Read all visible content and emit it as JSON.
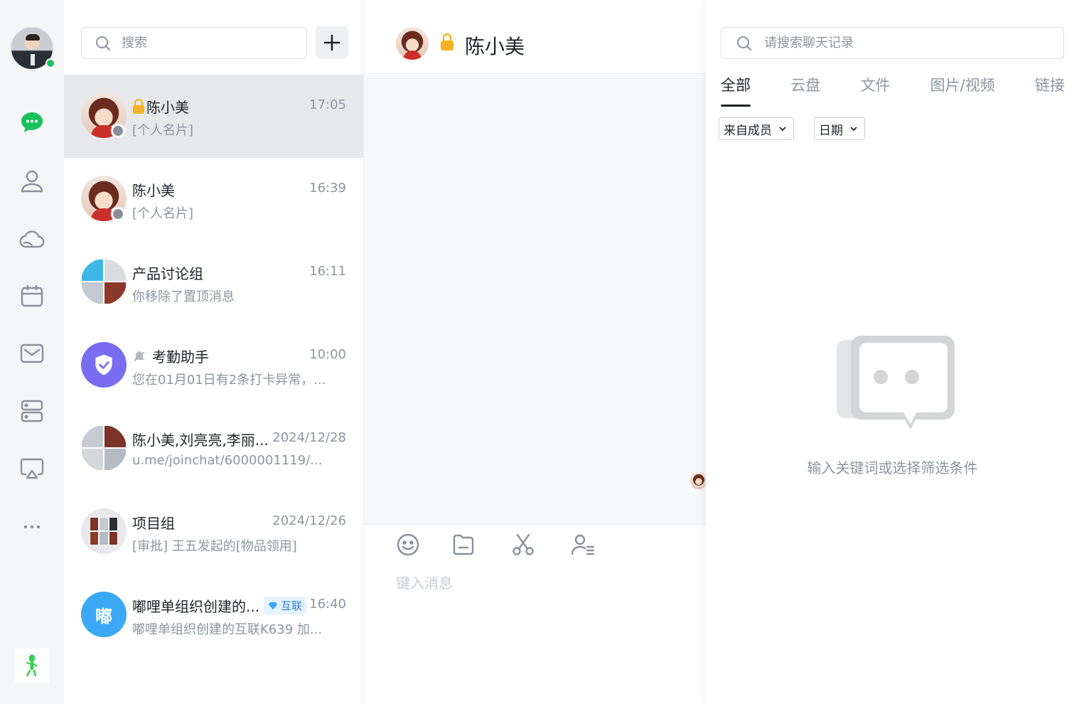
{
  "rail": {
    "items": [
      {
        "name": "messages",
        "icon": "chat-bubble-icon",
        "active": true
      },
      {
        "name": "contacts",
        "icon": "contact-icon"
      },
      {
        "name": "cloud",
        "icon": "cloud-icon"
      },
      {
        "name": "calendar",
        "icon": "calendar-icon"
      },
      {
        "name": "mail",
        "icon": "mail-icon"
      },
      {
        "name": "workspace",
        "icon": "workspace-icon"
      },
      {
        "name": "screencast",
        "icon": "screencast-icon"
      },
      {
        "name": "more",
        "icon": "more-icon"
      }
    ],
    "accent": "#19c25a"
  },
  "list": {
    "search_placeholder": "搜索",
    "conversations": [
      {
        "name": "陈小美",
        "time": "17:05",
        "preview": "[个人名片]",
        "locked": true
      },
      {
        "name": "陈小美",
        "time": "16:39",
        "preview": "[个人名片]"
      },
      {
        "name": "产品讨论组",
        "time": "16:11",
        "preview": "你移除了置顶消息"
      },
      {
        "name": "考勤助手",
        "time": "10:00",
        "preview": "您在01月01日有2条打卡异常，..."
      },
      {
        "name": "陈小美,刘亮亮,李丽...",
        "time": "2024/12/28",
        "preview": "u.me/joinchat/6000001119/..."
      },
      {
        "name": "项目组",
        "time": "2024/12/26",
        "preview": "[审批] 王五发起的[物品领用]"
      },
      {
        "name": "嘟哩单组织创建的...",
        "badge": "互联",
        "time": "16:40",
        "preview": "嘟哩单组织创建的互联K639 加...",
        "avatar_text": "嘟"
      }
    ]
  },
  "chat": {
    "title": "陈小美",
    "input_placeholder": "键入消息"
  },
  "panel": {
    "search_placeholder": "请搜索聊天记录",
    "tabs": [
      "全部",
      "云盘",
      "文件",
      "图片/视频",
      "链接"
    ],
    "filters": [
      "来自成员",
      "日期"
    ],
    "empty_text": "输入关键词或选择筛选条件"
  }
}
